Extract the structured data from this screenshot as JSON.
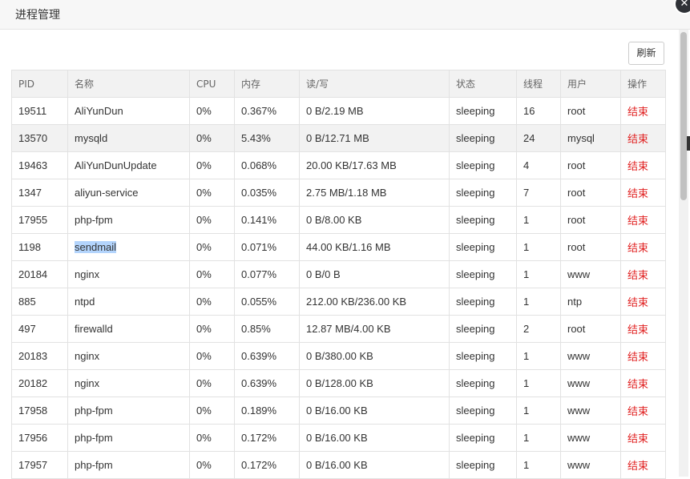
{
  "title": "进程管理",
  "refresh_label": "刷新",
  "close_glyph": "✕",
  "columns": [
    "PID",
    "名称",
    "CPU",
    "内存",
    "读/写",
    "状态",
    "线程",
    "用户",
    "操作"
  ],
  "rows": [
    {
      "pid": "19511",
      "name": "AliYunDun",
      "cpu": "0%",
      "mem": "0.367%",
      "io": "0 B/2.19 MB",
      "status": "sleeping",
      "threads": "16",
      "user": "root",
      "action": "结束"
    },
    {
      "pid": "13570",
      "name": "mysqld",
      "cpu": "0%",
      "mem": "5.43%",
      "io": "0 B/12.71 MB",
      "status": "sleeping",
      "threads": "24",
      "user": "mysql",
      "action": "结束"
    },
    {
      "pid": "19463",
      "name": "AliYunDunUpdate",
      "cpu": "0%",
      "mem": "0.068%",
      "io": "20.00 KB/17.63 MB",
      "status": "sleeping",
      "threads": "4",
      "user": "root",
      "action": "结束"
    },
    {
      "pid": "1347",
      "name": "aliyun-service",
      "cpu": "0%",
      "mem": "0.035%",
      "io": "2.75 MB/1.18 MB",
      "status": "sleeping",
      "threads": "7",
      "user": "root",
      "action": "结束"
    },
    {
      "pid": "17955",
      "name": "php-fpm",
      "cpu": "0%",
      "mem": "0.141%",
      "io": "0 B/8.00 KB",
      "status": "sleeping",
      "threads": "1",
      "user": "root",
      "action": "结束"
    },
    {
      "pid": "1198",
      "name": "sendmail",
      "cpu": "0%",
      "mem": "0.071%",
      "io": "44.00 KB/1.16 MB",
      "status": "sleeping",
      "threads": "1",
      "user": "root",
      "action": "结束"
    },
    {
      "pid": "20184",
      "name": "nginx",
      "cpu": "0%",
      "mem": "0.077%",
      "io": "0 B/0 B",
      "status": "sleeping",
      "threads": "1",
      "user": "www",
      "action": "结束"
    },
    {
      "pid": "885",
      "name": "ntpd",
      "cpu": "0%",
      "mem": "0.055%",
      "io": "212.00 KB/236.00 KB",
      "status": "sleeping",
      "threads": "1",
      "user": "ntp",
      "action": "结束"
    },
    {
      "pid": "497",
      "name": "firewalld",
      "cpu": "0%",
      "mem": "0.85%",
      "io": "12.87 MB/4.00 KB",
      "status": "sleeping",
      "threads": "2",
      "user": "root",
      "action": "结束"
    },
    {
      "pid": "20183",
      "name": "nginx",
      "cpu": "0%",
      "mem": "0.639%",
      "io": "0 B/380.00 KB",
      "status": "sleeping",
      "threads": "1",
      "user": "www",
      "action": "结束"
    },
    {
      "pid": "20182",
      "name": "nginx",
      "cpu": "0%",
      "mem": "0.639%",
      "io": "0 B/128.00 KB",
      "status": "sleeping",
      "threads": "1",
      "user": "www",
      "action": "结束"
    },
    {
      "pid": "17958",
      "name": "php-fpm",
      "cpu": "0%",
      "mem": "0.189%",
      "io": "0 B/16.00 KB",
      "status": "sleeping",
      "threads": "1",
      "user": "www",
      "action": "结束"
    },
    {
      "pid": "17956",
      "name": "php-fpm",
      "cpu": "0%",
      "mem": "0.172%",
      "io": "0 B/16.00 KB",
      "status": "sleeping",
      "threads": "1",
      "user": "www",
      "action": "结束"
    },
    {
      "pid": "17957",
      "name": "php-fpm",
      "cpu": "0%",
      "mem": "0.172%",
      "io": "0 B/16.00 KB",
      "status": "sleeping",
      "threads": "1",
      "user": "www",
      "action": "结束"
    }
  ],
  "selected_row_index": 5,
  "hover_row_index": 1,
  "colors": {
    "action": "#e02020",
    "header_bg": "#f2f2f2",
    "selection": "#b3d4fc"
  }
}
